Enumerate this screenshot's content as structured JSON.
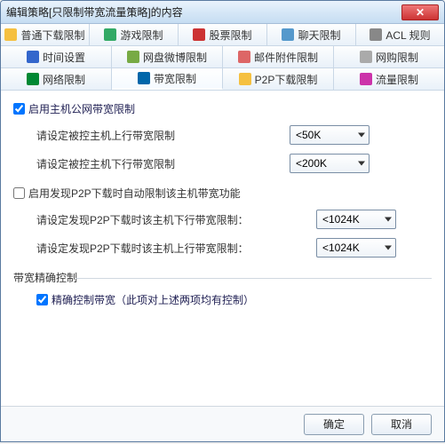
{
  "window": {
    "title": "编辑策略[只限制带宽流量策略]的内容"
  },
  "tabs": {
    "row1": [
      {
        "label": "普通下载限制"
      },
      {
        "label": "游戏限制"
      },
      {
        "label": "股票限制"
      },
      {
        "label": "聊天限制"
      },
      {
        "label": "ACL 规则"
      }
    ],
    "row2": [
      {
        "label": "时间设置"
      },
      {
        "label": "网盘微博限制"
      },
      {
        "label": "邮件附件限制"
      },
      {
        "label": "网购限制"
      }
    ],
    "row3": [
      {
        "label": "网络限制"
      },
      {
        "label": "带宽限制",
        "active": true
      },
      {
        "label": "P2P下载限制"
      },
      {
        "label": "流量限制"
      }
    ]
  },
  "section1": {
    "checkbox_label": "启用主机公网带宽限制",
    "checked": true,
    "up_label": "请设定被控主机上行带宽限制",
    "up_value": "<50K",
    "down_label": "请设定被控主机下行带宽限制",
    "down_value": "<200K"
  },
  "section2": {
    "checkbox_label": "启用发现P2P下载时自动限制该主机带宽功能",
    "checked": false,
    "down_label": "请设定发现P2P下载时该主机下行带宽限制：",
    "down_value": "<1024K",
    "up_label": "请设定发现P2P下载时该主机上行带宽限制：",
    "up_value": "<1024K"
  },
  "section3": {
    "group_title": "带宽精确控制",
    "checkbox_label": "精确控制带宽（此项对上述两项均有控制）",
    "checked": true
  },
  "footer": {
    "ok": "确定",
    "cancel": "取消"
  }
}
